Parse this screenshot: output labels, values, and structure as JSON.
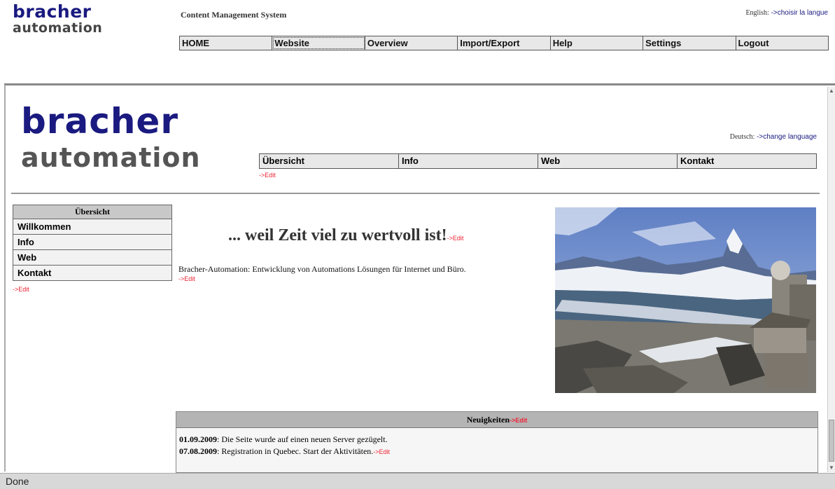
{
  "cms": {
    "logo_line1": "bracher",
    "logo_line2": "automation",
    "title": "Content Management System",
    "language_prefix": "English:",
    "language_link": "->choisir la langue",
    "nav": [
      "HOME",
      "Website",
      "Overview",
      "Import/Export",
      "Help",
      "Settings",
      "Logout"
    ],
    "active_nav": "Website"
  },
  "site": {
    "logo_line1": "bracher",
    "logo_line2": "automation",
    "language_prefix": "Deutsch:",
    "language_link": "->change language",
    "nav": [
      "Übersicht",
      "Info",
      "Web",
      "Kontakt"
    ],
    "edit_label": "->Edit"
  },
  "sidebar": {
    "header": "Übersicht",
    "items": [
      "Willkommen",
      "Info",
      "Web",
      "Kontakt"
    ]
  },
  "main": {
    "headline": "... weil Zeit viel zu wertvoll ist!",
    "description": "Bracher-Automation: Entwicklung von Automations Lösungen für Internet und Büro."
  },
  "news": {
    "title": "Neuigkeiten",
    "items": [
      {
        "date": "01.09.2009",
        "text": ": Die Seite wurde auf einen neuen Server gezügelt."
      },
      {
        "date": "07.08.2009",
        "text": ": Registration in Quebec. Start der Aktivitäten."
      }
    ]
  },
  "status": "Done",
  "colors": {
    "logo_blue": "#1a1a80",
    "edit_red": "#e23",
    "nav_bg": "#e8e8e8"
  }
}
